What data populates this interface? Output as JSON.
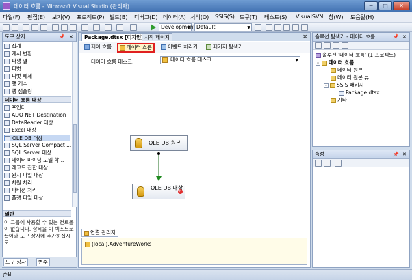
{
  "window": {
    "title": "데이터 흐름 - Microsoft Visual Studio (관리자)",
    "minimize": "─",
    "maximize": "□",
    "close": "✕"
  },
  "menu": [
    "파일(F)",
    "편집(E)",
    "보기(V)",
    "프로젝트(P)",
    "빌드(B)",
    "디버그(D)",
    "데이터(A)",
    "서식(O)",
    "SSIS(S)",
    "도구(T)",
    "테스트(S)",
    "VisualSVN",
    "창(W)",
    "도움말(H)"
  ],
  "toolbar": {
    "config": "Development",
    "platform": "Default",
    "dropdown_arrow": "▼"
  },
  "toolbox": {
    "title": "도구 상자",
    "pin": "📌",
    "close": "✕",
    "items_top": [
      "집계",
      "캐시 변환",
      "파생 열",
      "피벗",
      "피벗 해제",
      "행 개수",
      "행 샘플링"
    ],
    "category_dest": "데이터 흐름 대상",
    "items_dest": [
      "포인터",
      "ADO NET Destination",
      "DataReader 대상",
      "Excel 대상",
      "OLE DB 대상",
      "SQL Server Compact ...",
      "SQL Server 대상",
      "데이터 마이닝 모델 학...",
      "레코드 집합 대상",
      "원시 파일 대상",
      "차원 처리",
      "파티션 처리",
      "플랫 파일 대상"
    ],
    "selected_item": "OLE DB 대상",
    "category_general": "일반",
    "general_desc": "이 그룹에 사용할 수 있는 컨트롤이 없습니다. 항목을 이 텍스트로 끌어와 도구 상자에 추가하십시오.",
    "bottom_tab_1": "도구 상자",
    "bottom_tab_2": "변수"
  },
  "document": {
    "active_tab": "Package.dtsx [디자인]*",
    "inactive_tab": "시작 페이지",
    "close": "✕",
    "designer_tabs": [
      "제어 흐름",
      "데이터 흐름",
      "이벤트 처리기",
      "패키지 탐색기"
    ],
    "highlighted_tab": "데이터 흐름",
    "task_label": "데이터 흐름 태스크:",
    "task_value": "데이터 흐름 태스크",
    "source_component": "OLE DB 원본",
    "dest_component": "OLE DB 대상",
    "error_mark": "×",
    "conn_manager_title": "연결 관리자",
    "conn_item": "(local).AdventureWorks"
  },
  "solution": {
    "title": "솔루션 탐색기 - 데이터 흐름",
    "tree": [
      {
        "label": "솔루션 '데이터 흐름' (1 프로젝트)",
        "level": 0,
        "kind": "sln",
        "expander": ""
      },
      {
        "label": "데이터 흐름",
        "level": 1,
        "kind": "folder",
        "expander": "-"
      },
      {
        "label": "데이터 원본",
        "level": 2,
        "kind": "folder",
        "expander": ""
      },
      {
        "label": "데이터 원본 뷰",
        "level": 2,
        "kind": "folder",
        "expander": ""
      },
      {
        "label": "SSIS 패키지",
        "level": 2,
        "kind": "folder",
        "expander": "-"
      },
      {
        "label": "Package.dtsx",
        "level": 3,
        "kind": "pkg",
        "expander": ""
      },
      {
        "label": "기타",
        "level": 2,
        "kind": "folder",
        "expander": ""
      }
    ]
  },
  "properties": {
    "title": "속성"
  },
  "status": {
    "text": "준비"
  }
}
